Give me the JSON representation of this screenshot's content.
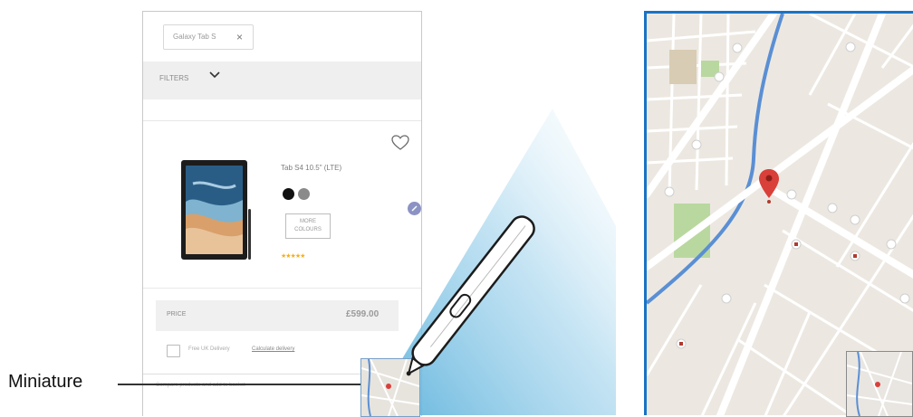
{
  "phone_screen": {
    "search_chip": {
      "text": "Galaxy Tab S",
      "close_symbol": "×"
    },
    "filter_label": "FILTERS",
    "product": {
      "title": "Tab S4 10.5\" (LTE)",
      "more_button": "MORE\nCOLOURS",
      "rating_stars": "★★★★★",
      "swatches": [
        "#111111",
        "#8a8a8a"
      ]
    },
    "price": {
      "label": "PRICE",
      "value": "£599.00"
    },
    "delivery": {
      "text": "Free UK Delivery",
      "link": "Calculate delivery"
    },
    "footer_text": "Compare products and add to basket"
  },
  "callout": {
    "label": "Miniature"
  },
  "colors": {
    "map_border": "#1a73c4",
    "pin": "#d9403a",
    "water": "#5b8fd4",
    "park": "#b9d8a0"
  }
}
